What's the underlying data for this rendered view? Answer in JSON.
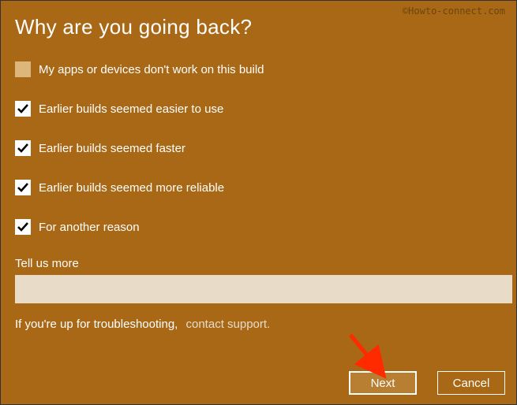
{
  "title": "Why are you going back?",
  "watermark": "©Howto-connect.com",
  "options": [
    {
      "label": "My apps or devices don't work on this build",
      "checked": false
    },
    {
      "label": "Earlier builds seemed easier to use",
      "checked": true
    },
    {
      "label": "Earlier builds seemed faster",
      "checked": true
    },
    {
      "label": "Earlier builds seemed more reliable",
      "checked": true
    },
    {
      "label": "For another reason",
      "checked": true
    }
  ],
  "tellus_label": "Tell us more",
  "tellus_value": "",
  "troubleshoot_text": "If you're up for troubleshooting,",
  "contact_link": "contact support.",
  "buttons": {
    "next": "Next",
    "cancel": "Cancel"
  }
}
